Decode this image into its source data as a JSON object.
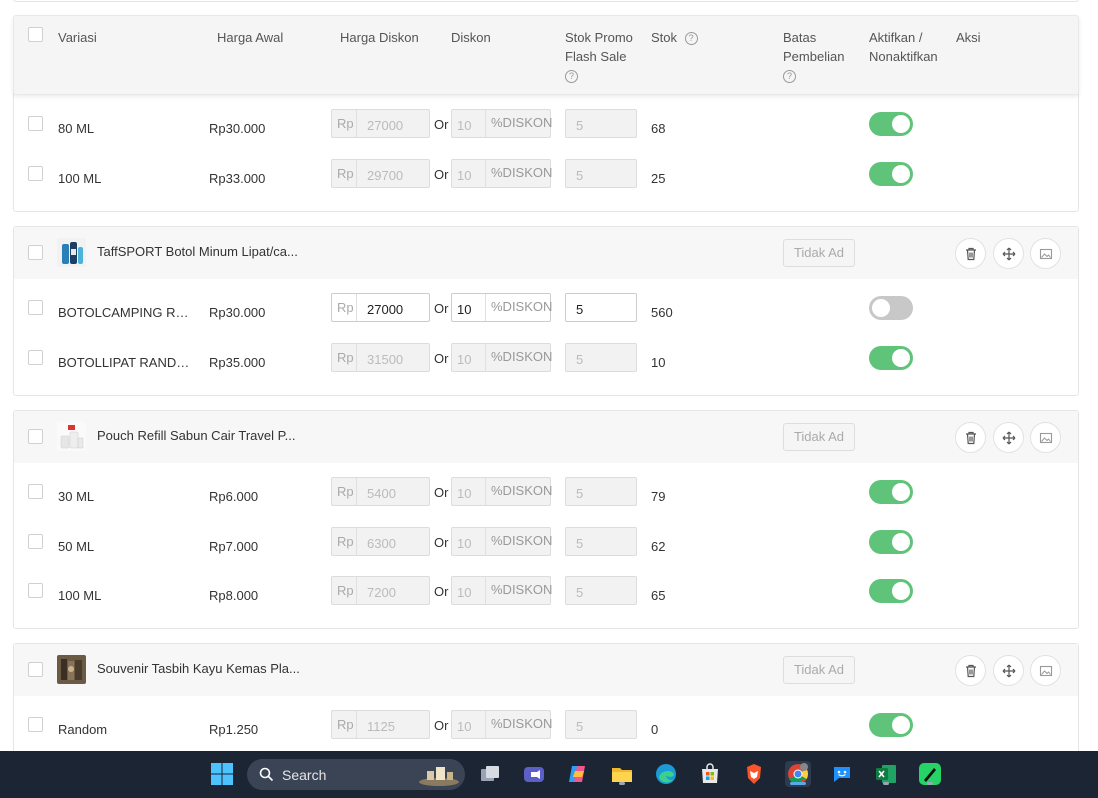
{
  "table": {
    "headers": {
      "variasi": "Variasi",
      "harga_awal": "Harga Awal",
      "harga_diskon": "Harga Diskon",
      "diskon": "Diskon",
      "stok_promo_1": "Stok Promo",
      "stok_promo_2": "Flash Sale",
      "stok": "Stok",
      "batas_1": "Batas",
      "batas_2": "Pembelian",
      "aktif_1": "Aktifkan /",
      "aktif_2": "Nonaktifkan",
      "aksi": "Aksi"
    },
    "rp_prefix": "Rp",
    "or_label": "Or",
    "pct_suffix": "%DISKON",
    "tidak_label": "Tidak Ad",
    "help_glyph": "?"
  },
  "group0": {
    "rows": [
      {
        "name": "80 ML",
        "price": "Rp30.000",
        "disc_price": "27000",
        "pct": "10",
        "promo_stock": "5",
        "stock": "68",
        "active": true
      },
      {
        "name": "100 ML",
        "price": "Rp33.000",
        "disc_price": "29700",
        "pct": "10",
        "promo_stock": "5",
        "stock": "25",
        "active": true
      }
    ]
  },
  "group1": {
    "product": "TaffSPORT Botol Minum Lipat/ca...",
    "rows": [
      {
        "name": "BOTOLCAMPING RAN...",
        "price": "Rp30.000",
        "disc_price": "27000",
        "pct": "10",
        "promo_stock": "5",
        "stock": "560",
        "active": false
      },
      {
        "name": "BOTOLLIPAT RANDOM",
        "price": "Rp35.000",
        "disc_price": "31500",
        "pct": "10",
        "promo_stock": "5",
        "stock": "10",
        "active": true
      }
    ]
  },
  "group2": {
    "product": "Pouch Refill Sabun Cair Travel P...",
    "rows": [
      {
        "name": "30 ML",
        "price": "Rp6.000",
        "disc_price": "5400",
        "pct": "10",
        "promo_stock": "5",
        "stock": "79",
        "active": true
      },
      {
        "name": "50 ML",
        "price": "Rp7.000",
        "disc_price": "6300",
        "pct": "10",
        "promo_stock": "5",
        "stock": "62",
        "active": true
      },
      {
        "name": "100 ML",
        "price": "Rp8.000",
        "disc_price": "7200",
        "pct": "10",
        "promo_stock": "5",
        "stock": "65",
        "active": true
      }
    ]
  },
  "group3": {
    "product": "Souvenir Tasbih Kayu Kemas Pla...",
    "rows": [
      {
        "name": "Random",
        "price": "Rp1.250",
        "disc_price": "1125",
        "pct": "10",
        "promo_stock": "5",
        "stock": "0",
        "active": true
      }
    ]
  },
  "taskbar": {
    "search_label": "Search",
    "icons": [
      "windows-start-icon",
      "file-explorer-icon",
      "teams-icon",
      "copilot-icon",
      "folder-icon",
      "edge-icon",
      "store-icon",
      "brave-icon",
      "chrome-icon",
      "messenger-icon",
      "excel-icon",
      "whatsapp-icon"
    ]
  },
  "colors": {
    "toggle_on": "#5fc47a",
    "toggle_off": "#c8c8c8",
    "taskbar_bg": "#1c2534"
  }
}
